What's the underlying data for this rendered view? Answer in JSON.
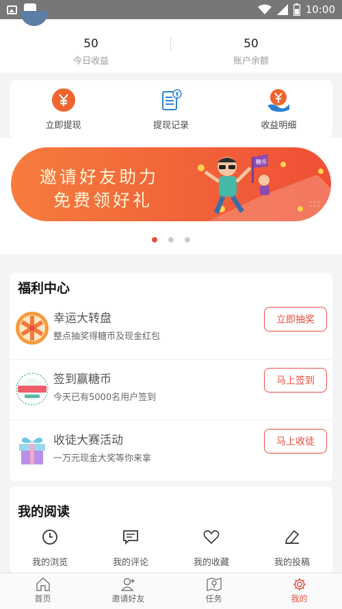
{
  "status_bar": {
    "time": "10:00"
  },
  "stats": [
    {
      "value": "50",
      "label": "今日收益"
    },
    {
      "value": "50",
      "label": "账户余额"
    }
  ],
  "quick_actions": [
    {
      "label": "立即提现",
      "icon": "yen-coin-icon"
    },
    {
      "label": "提现记录",
      "icon": "document-record-icon"
    },
    {
      "label": "收益明细",
      "icon": "yen-hand-icon"
    }
  ],
  "banner": {
    "line1": "邀请好友助力",
    "line2": "免费领好礼",
    "flag_text": "糖币",
    "active_slide": 1,
    "slide_count": 3
  },
  "welfare": {
    "title": "福利中心",
    "items": [
      {
        "title": "幸运大转盘",
        "subtitle": "整点抽奖得糖币及现金红包",
        "button": "立即抽奖",
        "icon": "wheel-icon"
      },
      {
        "title": "签到赢糖币",
        "subtitle": "今天已有5000名用户签到",
        "button": "马上签到",
        "icon": "signin-badge-icon"
      },
      {
        "title": "收徒大赛活动",
        "subtitle": "一万元现金大奖等你来拿",
        "button": "马上收徒",
        "icon": "gift-box-icon"
      }
    ]
  },
  "reading": {
    "title": "我的阅读",
    "items": [
      {
        "label": "我的浏览",
        "icon": "clock-icon"
      },
      {
        "label": "我的评论",
        "icon": "comment-icon"
      },
      {
        "label": "我的收藏",
        "icon": "heart-icon"
      },
      {
        "label": "我的投稿",
        "icon": "pen-icon"
      }
    ]
  },
  "tabs": [
    {
      "label": "首页",
      "icon": "home-icon"
    },
    {
      "label": "邀请好友",
      "icon": "add-user-icon"
    },
    {
      "label": "任务",
      "icon": "map-pin-icon"
    },
    {
      "label": "我的",
      "icon": "gear-icon"
    }
  ],
  "colors": {
    "accent": "#e84c3d",
    "orange": "#f0642d",
    "blue": "#2f80d1"
  }
}
